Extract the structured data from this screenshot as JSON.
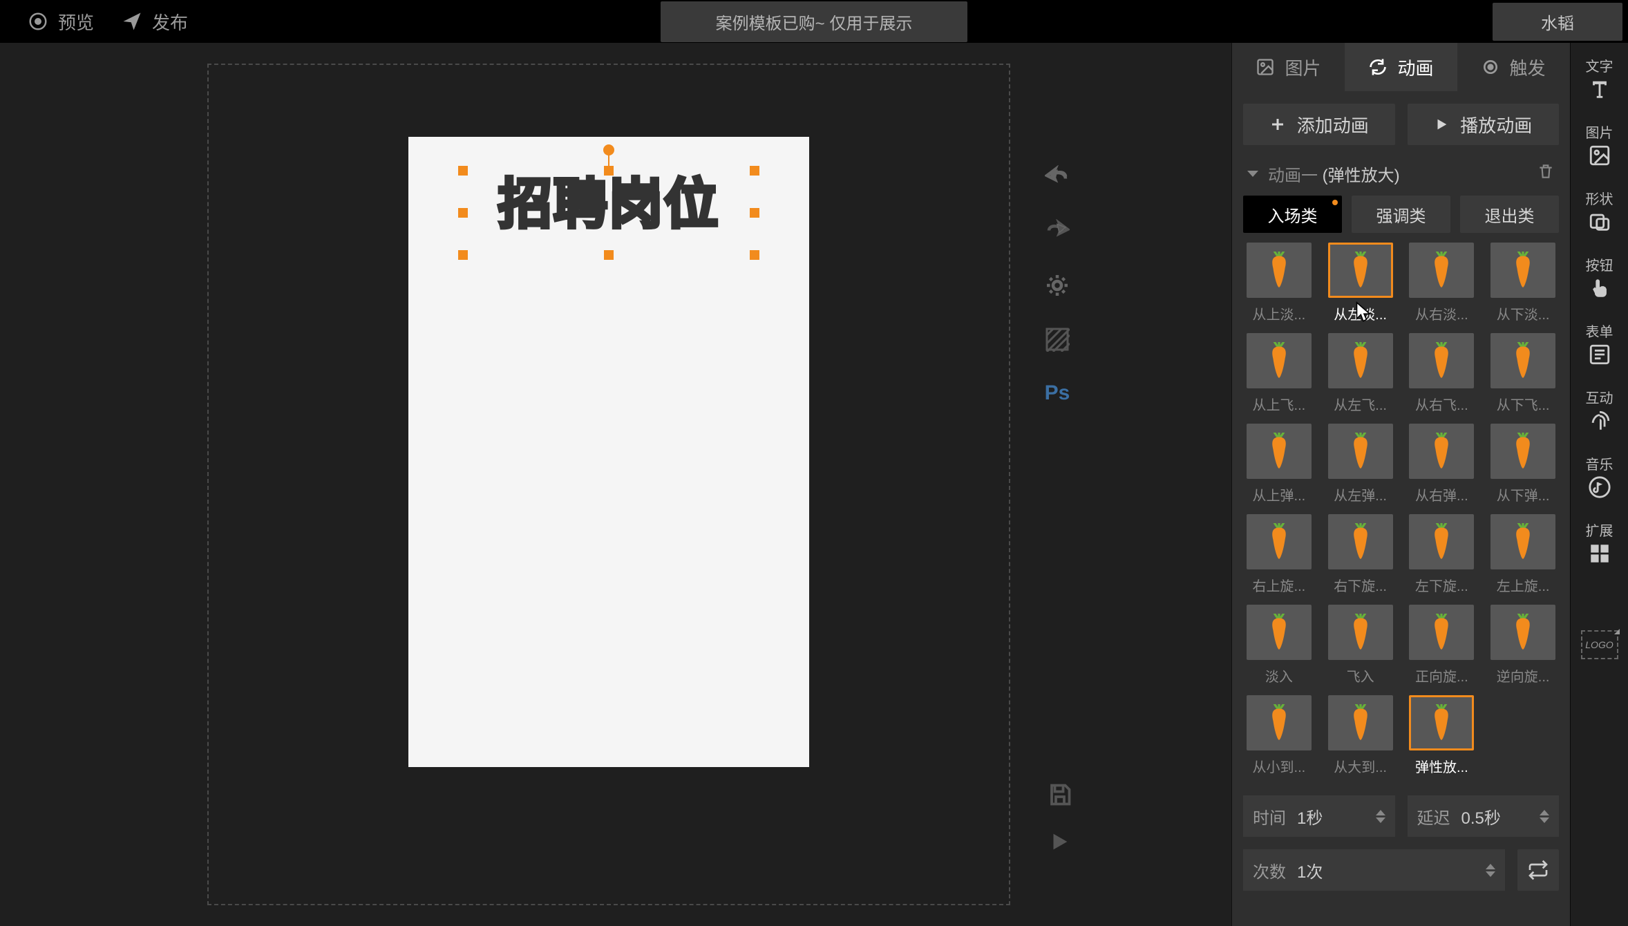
{
  "topbar": {
    "preview": "预览",
    "publish": "发布",
    "center": "案例模板已购~ 仅用于展示",
    "user": "水韬"
  },
  "canvas": {
    "heading_text": "招聘岗位"
  },
  "panel": {
    "tabs": {
      "image": "图片",
      "animation": "动画",
      "trigger": "触发"
    },
    "add_animation": "添加动画",
    "play_animation": "播放动画",
    "anim_label": "动画一",
    "anim_type": "(弹性放大)",
    "seg": {
      "in": "入场类",
      "emph": "强调类",
      "out": "退出类"
    },
    "grid": [
      {
        "label": "从上淡...",
        "sel": false
      },
      {
        "label": "从左淡...",
        "sel": true
      },
      {
        "label": "从右淡...",
        "sel": false
      },
      {
        "label": "从下淡...",
        "sel": false
      },
      {
        "label": "从上飞...",
        "sel": false
      },
      {
        "label": "从左飞...",
        "sel": false
      },
      {
        "label": "从右飞...",
        "sel": false
      },
      {
        "label": "从下飞...",
        "sel": false
      },
      {
        "label": "从上弹...",
        "sel": false
      },
      {
        "label": "从左弹...",
        "sel": false
      },
      {
        "label": "从右弹...",
        "sel": false
      },
      {
        "label": "从下弹...",
        "sel": false
      },
      {
        "label": "右上旋...",
        "sel": false
      },
      {
        "label": "右下旋...",
        "sel": false
      },
      {
        "label": "左下旋...",
        "sel": false
      },
      {
        "label": "左上旋...",
        "sel": false
      },
      {
        "label": "淡入",
        "sel": false
      },
      {
        "label": "飞入",
        "sel": false
      },
      {
        "label": "正向旋...",
        "sel": false
      },
      {
        "label": "逆向旋...",
        "sel": false
      },
      {
        "label": "从小到...",
        "sel": false
      },
      {
        "label": "从大到...",
        "sel": false
      },
      {
        "label": "弹性放...",
        "sel": true
      }
    ],
    "controls": {
      "time_label": "时间",
      "time_value": "1秒",
      "delay_label": "延迟",
      "delay_value": "0.5秒",
      "count_label": "次数",
      "count_value": "1次"
    }
  },
  "strip": {
    "text": "文字",
    "image": "图片",
    "shape": "形状",
    "button": "按钮",
    "form": "表单",
    "interact": "互动",
    "music": "音乐",
    "extend": "扩展",
    "logo": "LOGO"
  },
  "float_tools": {
    "ps": "Ps"
  },
  "colors": {
    "accent": "#f28b1d"
  }
}
